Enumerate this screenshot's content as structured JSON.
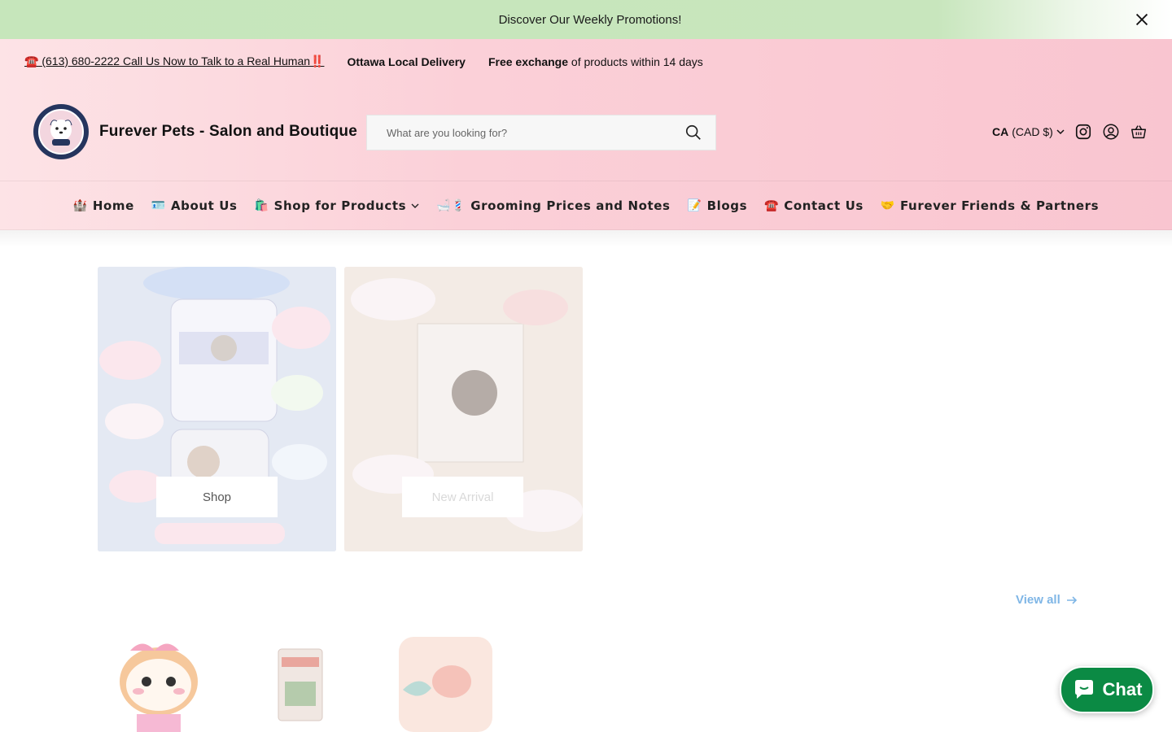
{
  "announcement": {
    "text": "Discover Our Weekly Promotions!"
  },
  "topbar": {
    "phone_icon": "☎️",
    "phone_text": "(613) 680-2222 Call Us Now to Talk to a Real Human",
    "phone_suffix": "‼️",
    "delivery": "Ottawa Local Delivery",
    "exchange_bold": "Free exchange",
    "exchange_rest": " of products within 14 days"
  },
  "header": {
    "brand": "Furever Pets - Salon and Boutique",
    "search_placeholder": "What are you looking for?",
    "country": "CA",
    "currency": "(CAD $)"
  },
  "nav": [
    {
      "emoji": "🏰",
      "label": "Home"
    },
    {
      "emoji": "🪪",
      "label": "About Us"
    },
    {
      "emoji": "🛍️",
      "label": "Shop for Products"
    },
    {
      "emoji": "🛁💈",
      "label": "Grooming Prices and Notes"
    },
    {
      "emoji": "📝",
      "label": "Blogs"
    },
    {
      "emoji": "☎️",
      "label": "Contact Us"
    },
    {
      "emoji": "🤝",
      "label": "Furever Friends & Partners"
    }
  ],
  "cards": [
    {
      "button": "Shop"
    },
    {
      "button": "New Arrival"
    }
  ],
  "collection": {
    "view_all": "View all"
  },
  "chat": {
    "label": "Chat"
  },
  "colors": {
    "announce_bg": "#c6e6bb",
    "pink": "#f9c5d0",
    "link_blue": "#7fb6e6",
    "chat_green": "#0b8a44"
  }
}
